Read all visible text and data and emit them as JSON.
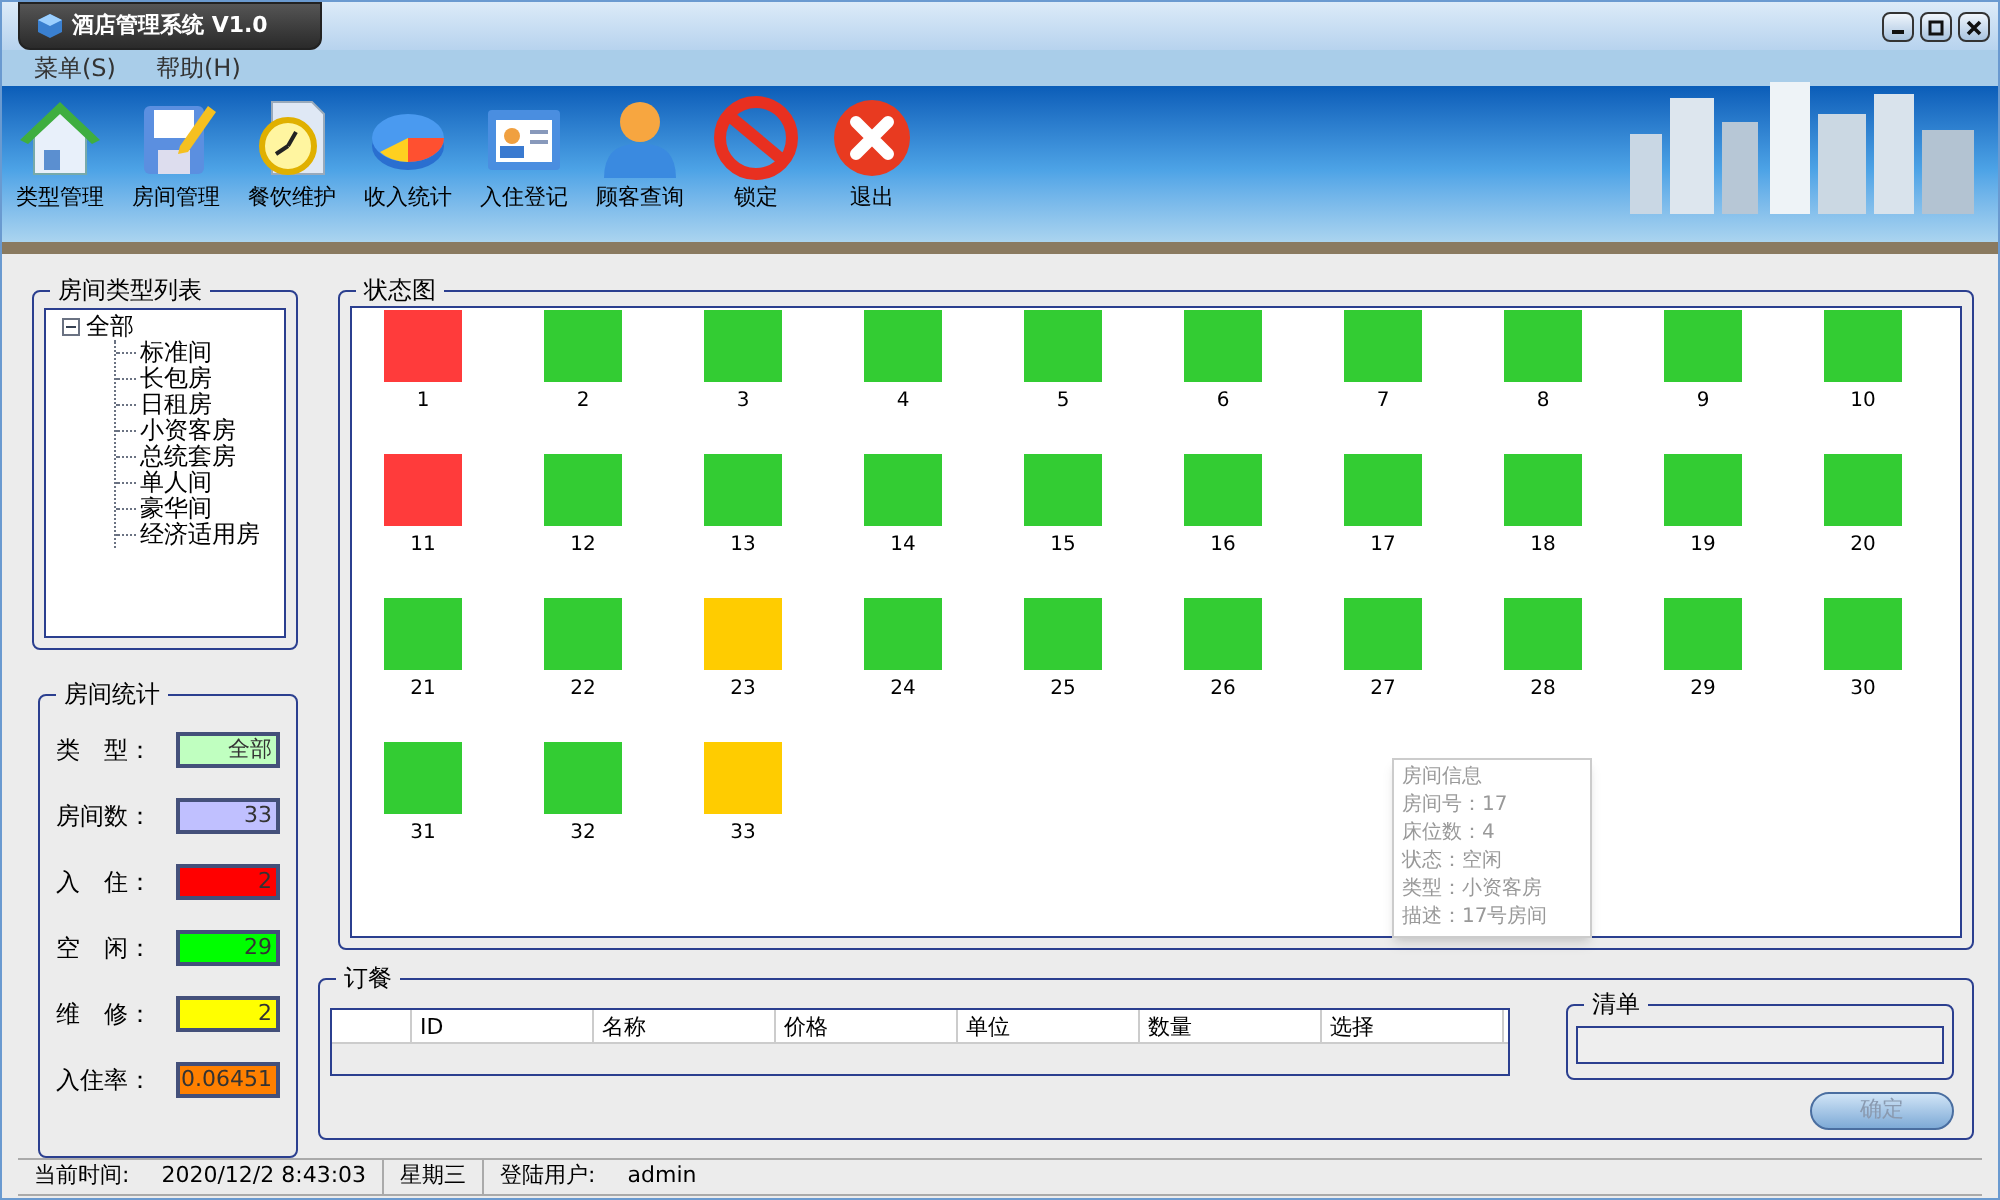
{
  "window": {
    "title": "酒店管理系统 V1.0"
  },
  "menu": [
    "菜单(S)",
    "帮助(H)"
  ],
  "toolbar": [
    "类型管理",
    "房间管理",
    "餐饮维护",
    "收入统计",
    "入住登记",
    "顾客查询",
    "锁定",
    "退出"
  ],
  "room_types": {
    "title": "房间类型列表",
    "tree": [
      {
        "label": "全部",
        "expanded": true,
        "children": [
          {
            "label": "标准间"
          },
          {
            "label": "长包房"
          },
          {
            "label": "日租房"
          },
          {
            "label": "小资客房"
          },
          {
            "label": "总统套房"
          },
          {
            "label": "单人间"
          },
          {
            "label": "豪华间"
          },
          {
            "label": "经济适用房"
          }
        ]
      }
    ]
  },
  "stats": {
    "title": "房间统计",
    "rows": [
      {
        "label": "类　型：",
        "value": "全部",
        "color": "#c0ffc0"
      },
      {
        "label": "房间数：",
        "value": "33",
        "color": "#c0c0ff"
      },
      {
        "label": "入　住：",
        "value": "2",
        "color": "#ff0000"
      },
      {
        "label": "空　闲：",
        "value": "29",
        "color": "#00ff00"
      },
      {
        "label": "维　修：",
        "value": "2",
        "color": "#ffff00"
      },
      {
        "label": "入住率：",
        "value": "0.06451",
        "color": "#ff8000"
      }
    ]
  },
  "status_map": {
    "title": "状态图",
    "rooms": [
      {
        "number": "1",
        "color": "#ff3b3b"
      },
      {
        "number": "2",
        "color": "#33cc33"
      },
      {
        "number": "3",
        "color": "#33cc33"
      },
      {
        "number": "4",
        "color": "#33cc33"
      },
      {
        "number": "5",
        "color": "#33cc33"
      },
      {
        "number": "6",
        "color": "#33cc33"
      },
      {
        "number": "7",
        "color": "#33cc33"
      },
      {
        "number": "8",
        "color": "#33cc33"
      },
      {
        "number": "9",
        "color": "#33cc33"
      },
      {
        "number": "10",
        "color": "#33cc33"
      },
      {
        "number": "11",
        "color": "#ff3b3b"
      },
      {
        "number": "12",
        "color": "#33cc33"
      },
      {
        "number": "13",
        "color": "#33cc33"
      },
      {
        "number": "14",
        "color": "#33cc33"
      },
      {
        "number": "15",
        "color": "#33cc33"
      },
      {
        "number": "16",
        "color": "#33cc33"
      },
      {
        "number": "17",
        "color": "#33cc33"
      },
      {
        "number": "18",
        "color": "#33cc33"
      },
      {
        "number": "19",
        "color": "#33cc33"
      },
      {
        "number": "20",
        "color": "#33cc33"
      },
      {
        "number": "21",
        "color": "#33cc33"
      },
      {
        "number": "22",
        "color": "#33cc33"
      },
      {
        "number": "23",
        "color": "#ffcc00"
      },
      {
        "number": "24",
        "color": "#33cc33"
      },
      {
        "number": "25",
        "color": "#33cc33"
      },
      {
        "number": "26",
        "color": "#33cc33"
      },
      {
        "number": "27",
        "color": "#33cc33"
      },
      {
        "number": "28",
        "color": "#33cc33"
      },
      {
        "number": "29",
        "color": "#33cc33"
      },
      {
        "number": "30",
        "color": "#33cc33"
      },
      {
        "number": "31",
        "color": "#33cc33"
      },
      {
        "number": "32",
        "color": "#33cc33"
      },
      {
        "number": "33",
        "color": "#ffcc00"
      }
    ],
    "tooltip": [
      "房间信息",
      "房间号：17",
      "床位数：4",
      "状态：空闲",
      "类型：小资客房",
      "描述：17号房间"
    ]
  },
  "order": {
    "title": "订餐",
    "columns": [
      "ID",
      "名称",
      "价格",
      "单位",
      "数量",
      "选择"
    ],
    "list_title": "清单",
    "confirm": {
      "label": "确定",
      "disabled": true
    }
  },
  "status_bar": [
    "当前时间:",
    "2020/12/2 8:43:03",
    "星期三",
    "登陆用户:",
    "admin"
  ]
}
